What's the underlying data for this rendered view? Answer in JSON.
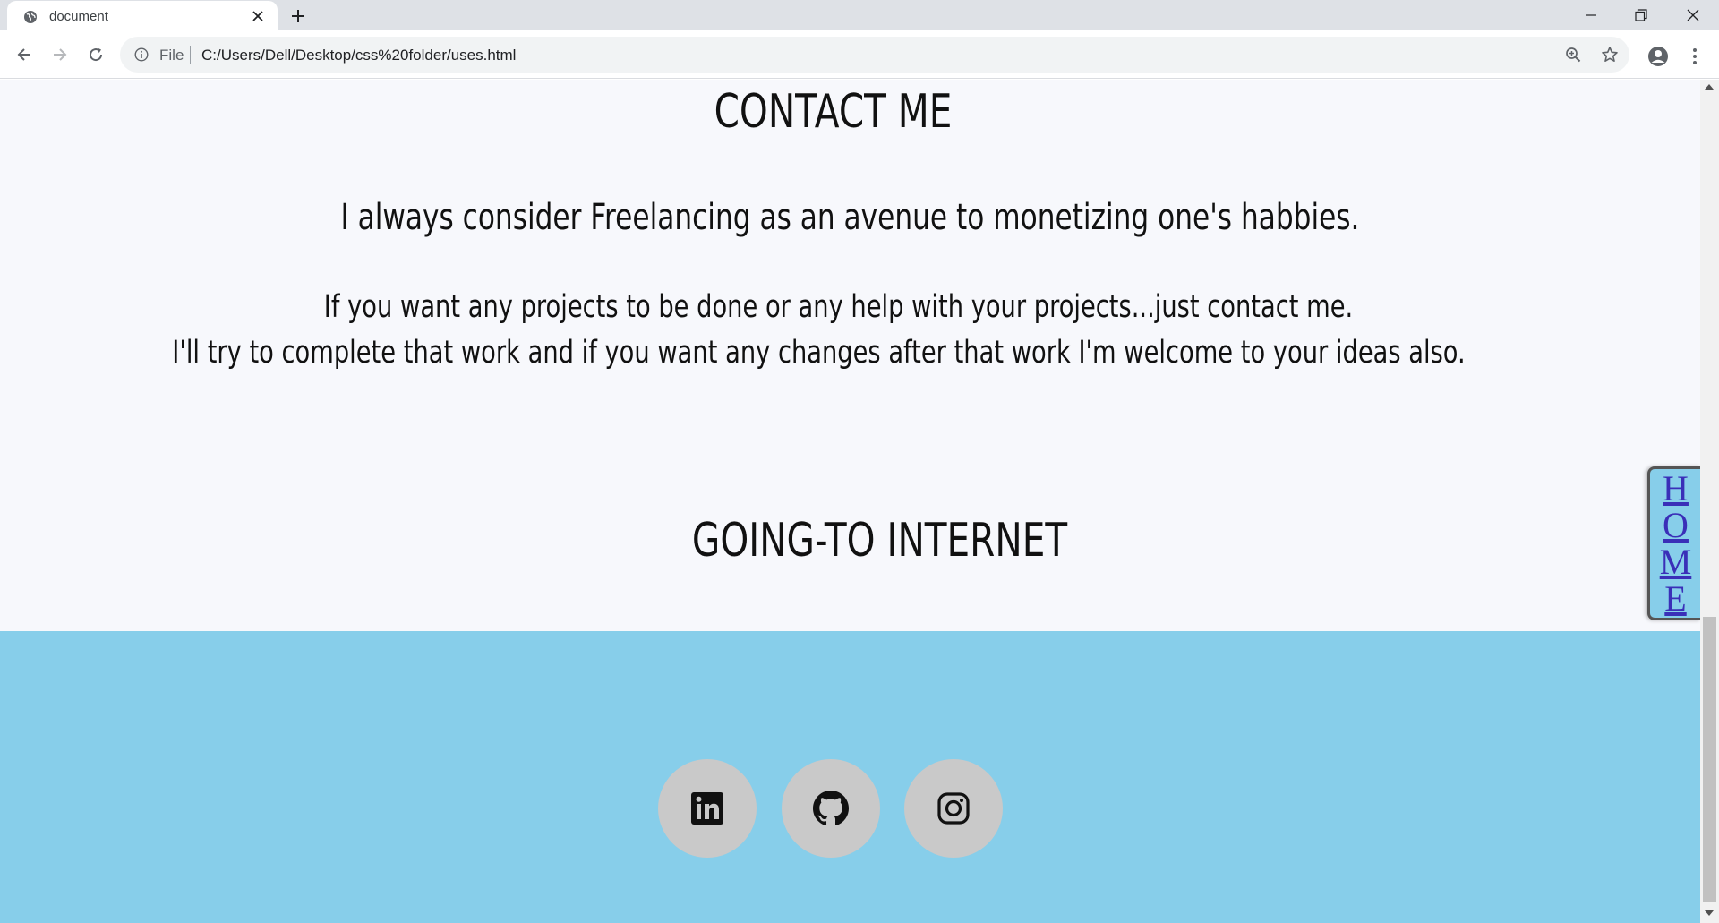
{
  "browser": {
    "tab_title": "document",
    "address_scheme": "File",
    "url": "C:/Users/Dell/Desktop/css%20folder/uses.html"
  },
  "page": {
    "contact_heading": "CONTACT ME",
    "tagline": "I always consider Freelancing as an avenue to monetizing one's habbies.",
    "paragraph_line1": "If you want any projects to be done or any help with your projects...just contact me.",
    "paragraph_line2": "I'll try to complete that work and if you want any changes after that work I'm welcome to your ideas also.",
    "going_heading": "GOING-TO INTERNET",
    "home_letters": [
      "H",
      "O",
      "M",
      "E"
    ],
    "social_links": [
      "linkedin-icon",
      "github-icon",
      "instagram-icon"
    ]
  },
  "colors": {
    "page_bg": "#f7f8fc",
    "footer_bg": "#87ceea",
    "social_circle": "#c9c9c9",
    "home_link": "#3a2fb8"
  }
}
